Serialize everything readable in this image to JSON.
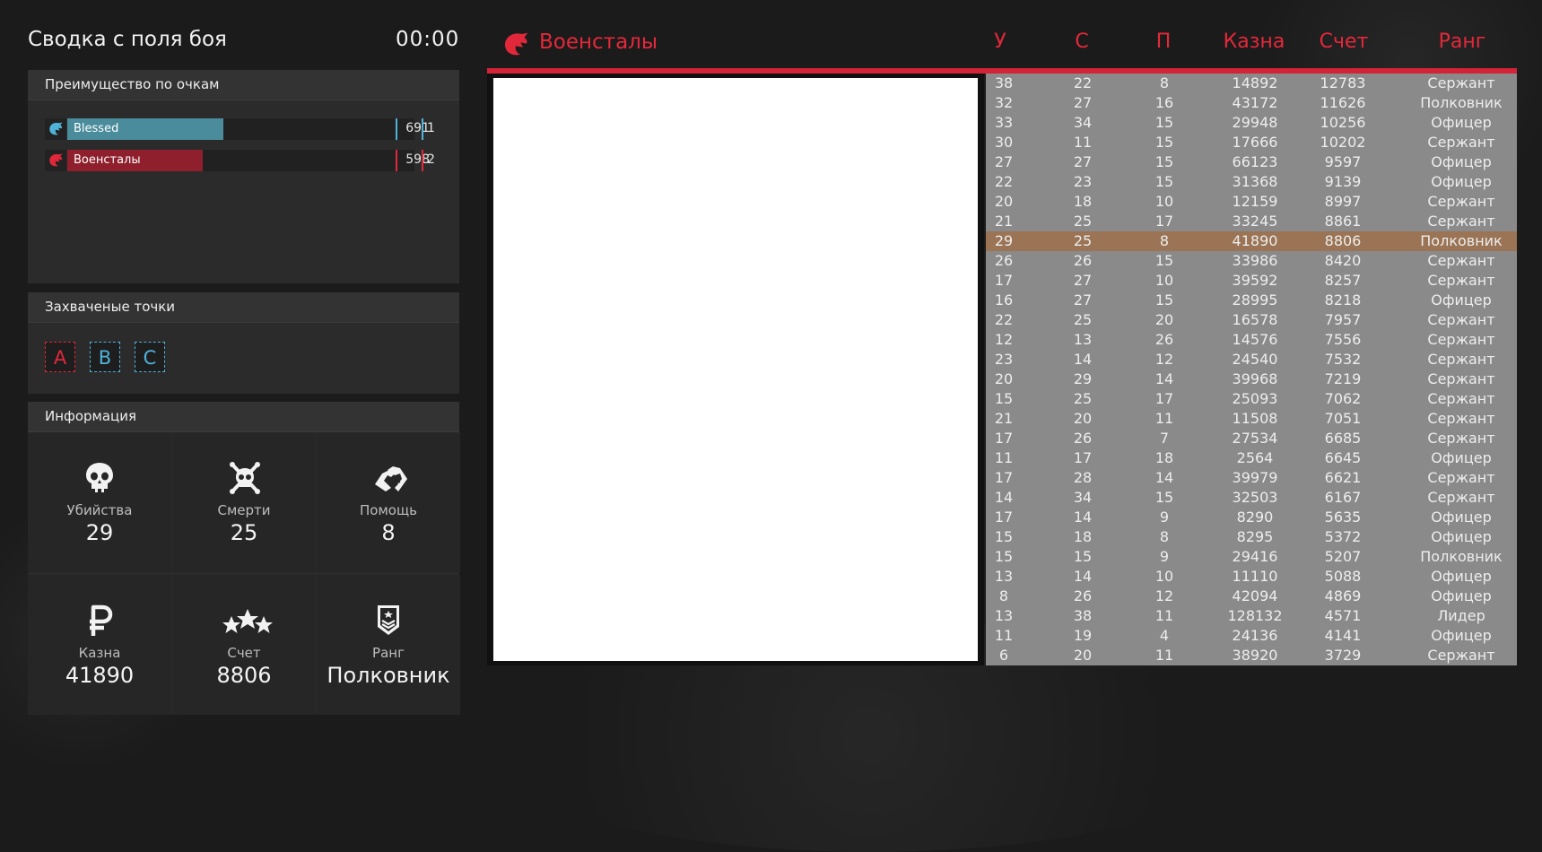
{
  "header": {
    "title": "Сводка с поля боя",
    "timer": "00:00"
  },
  "advantage": {
    "title": "Преимущество по очкам",
    "teams": [
      {
        "name": "Blessed",
        "score": "691",
        "place": "1",
        "color": "#4a8c9b",
        "fill_fraction": 0.45
      },
      {
        "name": "Военсталы",
        "score": "598",
        "place": "2",
        "color": "#8f1f2c",
        "fill_fraction": 0.39
      }
    ]
  },
  "captures": {
    "title": "Захваченые точки",
    "points": [
      {
        "label": "A",
        "color": "#e0283a"
      },
      {
        "label": "B",
        "color": "#4fb3d9"
      },
      {
        "label": "C",
        "color": "#4fb3d9"
      }
    ]
  },
  "info": {
    "title": "Информация",
    "stats": [
      {
        "label": "Убийства",
        "value": "29",
        "icon": "skull-icon"
      },
      {
        "label": "Смерти",
        "value": "25",
        "icon": "skull-crossbones-icon"
      },
      {
        "label": "Помощь",
        "value": "8",
        "icon": "handshake-icon"
      },
      {
        "label": "Казна",
        "value": "41890",
        "icon": "ruble-icon"
      },
      {
        "label": "Счет",
        "value": "8806",
        "icon": "stars-icon"
      },
      {
        "label": "Ранг",
        "value": "Полковник",
        "icon": "rank-badge-icon"
      }
    ]
  },
  "roster": {
    "team_name": "Военсталы",
    "team_color": "#e5283a",
    "columns": [
      "У",
      "С",
      "П",
      "Казна",
      "Счет",
      "Ранг"
    ],
    "highlight_row": 8,
    "rows": [
      [
        "38",
        "22",
        "8",
        "14892",
        "12783",
        "Сержант"
      ],
      [
        "32",
        "27",
        "16",
        "43172",
        "11626",
        "Полковник"
      ],
      [
        "33",
        "34",
        "15",
        "29948",
        "10256",
        "Офицер"
      ],
      [
        "30",
        "11",
        "15",
        "17666",
        "10202",
        "Сержант"
      ],
      [
        "27",
        "27",
        "15",
        "66123",
        "9597",
        "Офицер"
      ],
      [
        "22",
        "23",
        "15",
        "31368",
        "9139",
        "Офицер"
      ],
      [
        "20",
        "18",
        "10",
        "12159",
        "8997",
        "Сержант"
      ],
      [
        "21",
        "25",
        "17",
        "33245",
        "8861",
        "Сержант"
      ],
      [
        "29",
        "25",
        "8",
        "41890",
        "8806",
        "Полковник"
      ],
      [
        "26",
        "26",
        "15",
        "33986",
        "8420",
        "Сержант"
      ],
      [
        "17",
        "27",
        "10",
        "39592",
        "8257",
        "Сержант"
      ],
      [
        "16",
        "27",
        "15",
        "28995",
        "8218",
        "Офицер"
      ],
      [
        "22",
        "25",
        "20",
        "16578",
        "7957",
        "Сержант"
      ],
      [
        "12",
        "13",
        "26",
        "14576",
        "7556",
        "Сержант"
      ],
      [
        "23",
        "14",
        "12",
        "24540",
        "7532",
        "Сержант"
      ],
      [
        "20",
        "29",
        "14",
        "39968",
        "7219",
        "Сержант"
      ],
      [
        "15",
        "25",
        "17",
        "25093",
        "7062",
        "Сержант"
      ],
      [
        "21",
        "20",
        "11",
        "11508",
        "7051",
        "Сержант"
      ],
      [
        "17",
        "26",
        "7",
        "27534",
        "6685",
        "Сержант"
      ],
      [
        "11",
        "17",
        "18",
        "2564",
        "6645",
        "Офицер"
      ],
      [
        "17",
        "28",
        "14",
        "39979",
        "6621",
        "Сержант"
      ],
      [
        "14",
        "34",
        "15",
        "32503",
        "6167",
        "Сержант"
      ],
      [
        "17",
        "14",
        "9",
        "8290",
        "5635",
        "Офицер"
      ],
      [
        "15",
        "18",
        "8",
        "8295",
        "5372",
        "Офицер"
      ],
      [
        "15",
        "15",
        "9",
        "29416",
        "5207",
        "Полковник"
      ],
      [
        "13",
        "14",
        "10",
        "11110",
        "5088",
        "Офицер"
      ],
      [
        "8",
        "26",
        "12",
        "42094",
        "4869",
        "Офицер"
      ],
      [
        "13",
        "38",
        "11",
        "128132",
        "4571",
        "Лидер"
      ],
      [
        "11",
        "19",
        "4",
        "24136",
        "4141",
        "Офицер"
      ],
      [
        "6",
        "20",
        "11",
        "38920",
        "3729",
        "Сержант"
      ]
    ]
  }
}
